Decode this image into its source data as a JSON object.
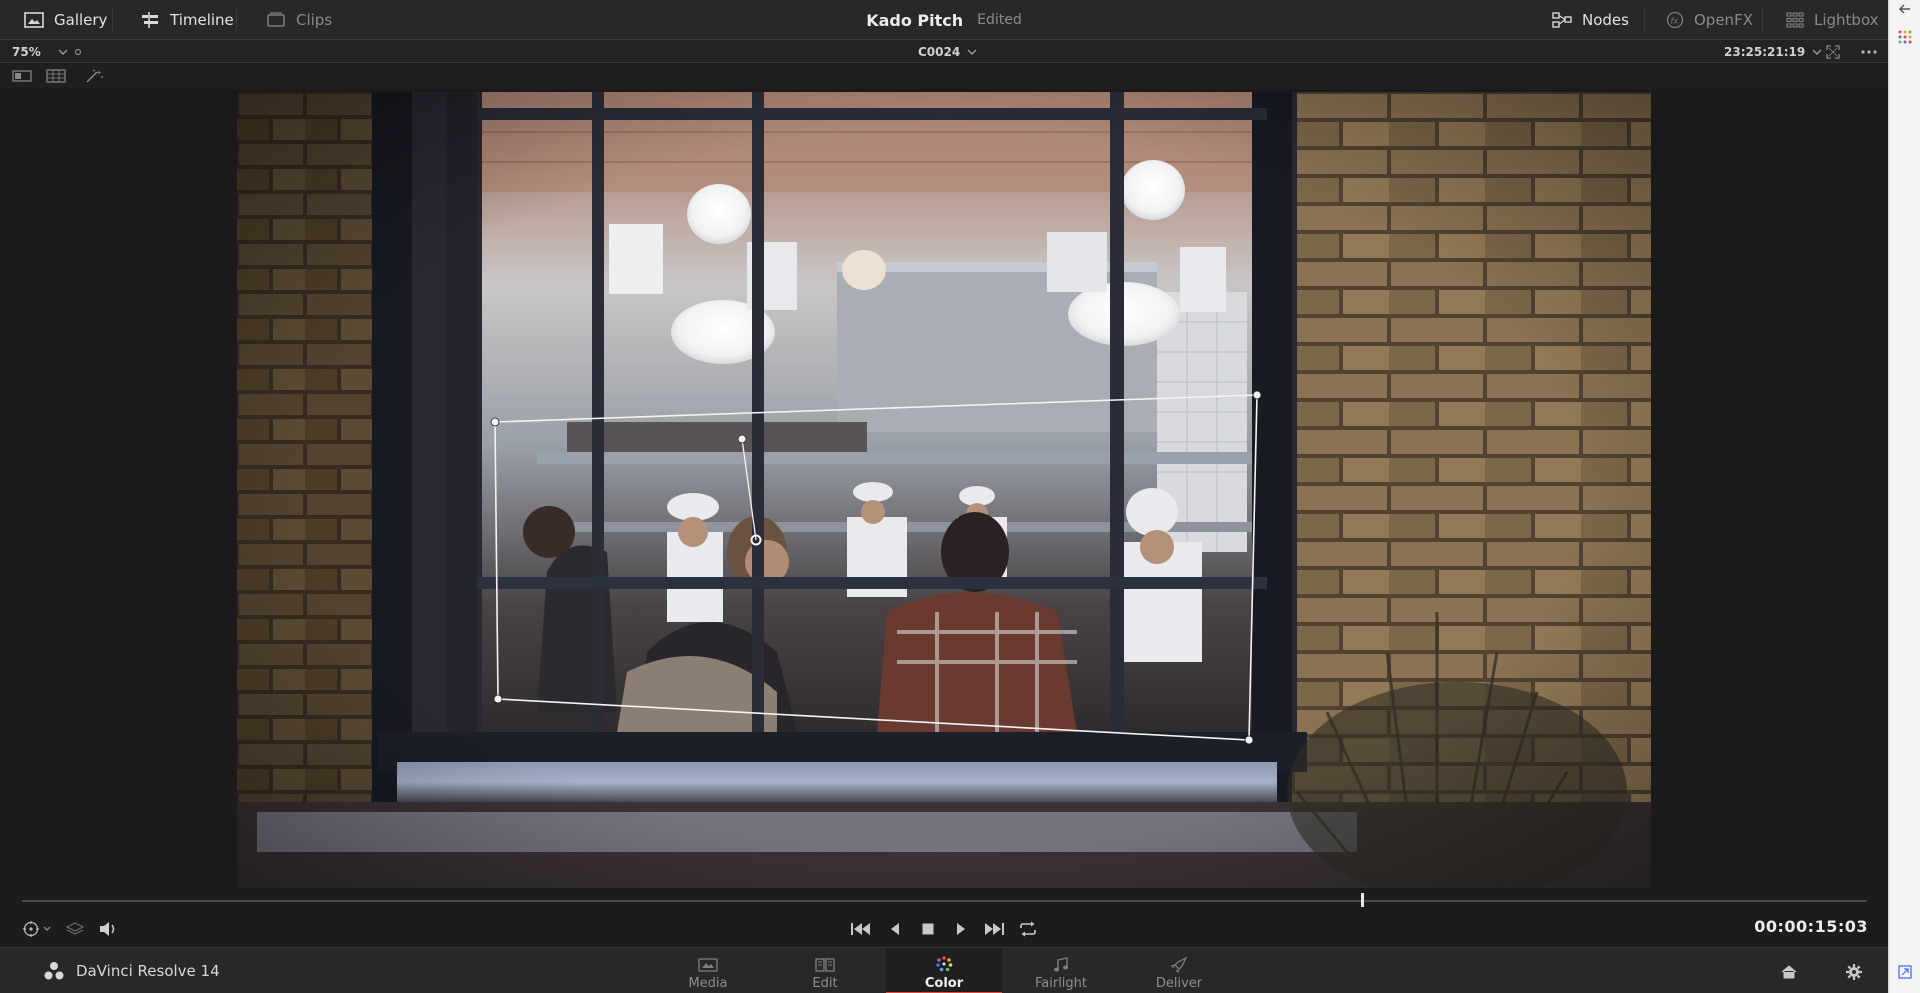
{
  "topbar": {
    "gallery_label": "Gallery",
    "timeline_label": "Timeline",
    "clips_label": "Clips",
    "project_title": "Kado Pitch",
    "project_status": "Edited",
    "nodes_label": "Nodes",
    "openfx_label": "OpenFX",
    "lightbox_label": "Lightbox"
  },
  "viewer_header": {
    "zoom": "75%",
    "clip_name": "C0024",
    "source_timecode": "23:25:21:19"
  },
  "transport": {
    "timecode": "00:00:15:03"
  },
  "pages": {
    "app_name": "DaVinci Resolve 14",
    "media": "Media",
    "edit": "Edit",
    "color": "Color",
    "fairlight": "Fairlight",
    "deliver": "Deliver",
    "active": "Color"
  },
  "playhead_position": 0.726,
  "colors": {
    "accent": "#e3463f",
    "background": "#1c1c1e",
    "panel": "#28282b"
  }
}
